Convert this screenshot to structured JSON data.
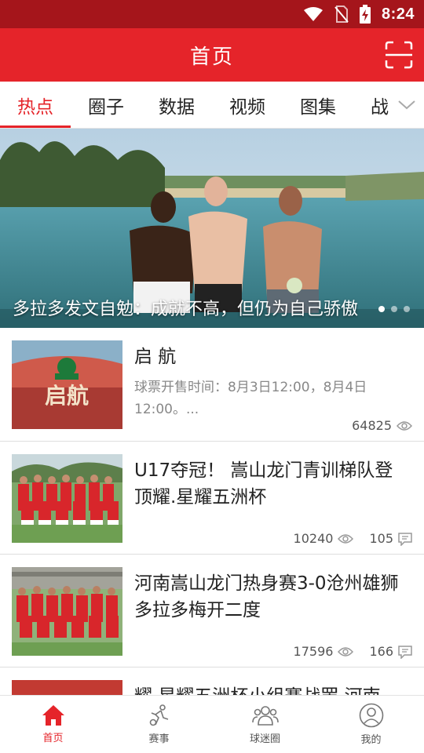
{
  "status_bar": {
    "time": "8:24"
  },
  "header": {
    "title": "首页"
  },
  "tabs": [
    {
      "label": "热点",
      "active": true
    },
    {
      "label": "圈子"
    },
    {
      "label": "数据"
    },
    {
      "label": "视频"
    },
    {
      "label": "图集"
    },
    {
      "label": "战"
    }
  ],
  "banner": {
    "caption": "多拉多发文自勉：成就不高，但仍为自己骄傲",
    "dots": 3,
    "active_dot": 0
  },
  "news": [
    {
      "title": "启 航",
      "desc": "球票开售时间：8月3日12:00，8月4日12:00。...",
      "views": "64825",
      "thumb_text": "启航"
    },
    {
      "title": "U17夺冠！ 嵩山龙门青训梯队登顶耀.星耀五洲杯",
      "views": "10240",
      "comments": "105"
    },
    {
      "title": "河南嵩山龙门热身赛3-0沧州雄狮 多拉多梅开二度",
      "views": "17596",
      "comments": "166"
    },
    {
      "title": "耀.星耀五洲杯小组赛战罢 河南"
    }
  ],
  "bottom_nav": [
    {
      "label": "首页",
      "icon": "home-icon",
      "active": true
    },
    {
      "label": "赛事",
      "icon": "soccer-player-icon"
    },
    {
      "label": "球迷圈",
      "icon": "fans-group-icon"
    },
    {
      "label": "我的",
      "icon": "profile-icon"
    }
  ],
  "colors": {
    "brand": "#e5242a",
    "status_bar": "#a5151b"
  }
}
